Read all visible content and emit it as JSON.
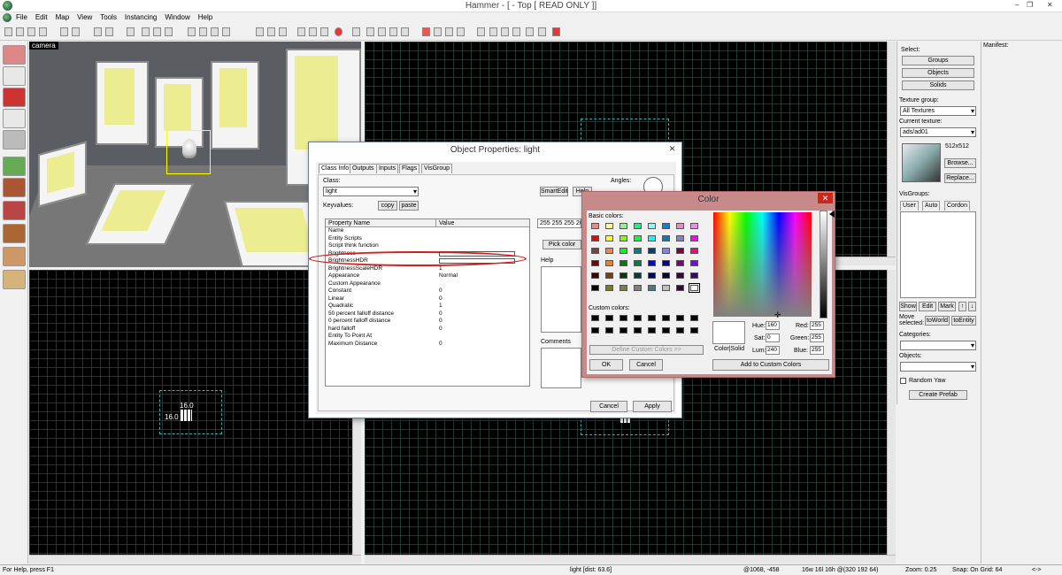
{
  "window": {
    "title": "Hammer - [ - Top [ READ ONLY ]]",
    "controls": [
      "–",
      "❐",
      "✕"
    ]
  },
  "menu": [
    "File",
    "Edit",
    "Map",
    "View",
    "Tools",
    "Instancing",
    "Window",
    "Help"
  ],
  "viewport3d": {
    "label": "camera"
  },
  "viewports": {
    "side_labels": [
      "16.0",
      "16.0"
    ],
    "size_w": "16.0",
    "size_h": "16.0"
  },
  "select_panel": {
    "select_label": "Select:",
    "groups": "Groups",
    "objects": "Objects",
    "solids": "Solids",
    "texture_group_label": "Texture group:",
    "texture_group": "All Textures",
    "current_texture_label": "Current texture:",
    "current_texture": "ads/ad01",
    "texture_size": "512x512",
    "browse": "Browse...",
    "replace": "Replace...",
    "visgroups_label": "VisGroups:",
    "vis_tabs": [
      "User",
      "Auto",
      "Cordon"
    ],
    "show": "Show",
    "edit": "Edit",
    "mark": "Mark",
    "up": "↑",
    "down": "↓",
    "move_selected": "Move selected:",
    "to_world": "toWorld",
    "to_entity": "toEntity",
    "categories_label": "Categories:",
    "objects_label": "Objects:",
    "random_yaw": "Random Yaw",
    "create_prefab": "Create Prefab"
  },
  "manifest": {
    "label": "Manifest:"
  },
  "object_properties": {
    "title": "Object Properties: light",
    "tabs": [
      "Class Info",
      "Outputs",
      "Inputs",
      "Flags",
      "VisGroup"
    ],
    "class_label": "Class:",
    "class_value": "light",
    "keyvalues_label": "Keyvalues:",
    "copy": "copy",
    "paste": "paste",
    "smartedit": "SmartEdit",
    "help_btn": "Help",
    "angles_label": "Angles:",
    "col_property": "Property Name",
    "col_value": "Value",
    "rows": [
      {
        "name": "Name",
        "value": ""
      },
      {
        "name": "Entity Scripts",
        "value": ""
      },
      {
        "name": "Script think function",
        "value": ""
      },
      {
        "name": "Brightness",
        "value": ""
      },
      {
        "name": "BrightnessHDR",
        "value": ""
      },
      {
        "name": "BrightnessScaleHDR",
        "value": "1"
      },
      {
        "name": "Appearance",
        "value": "Normal"
      },
      {
        "name": "Custom Appearance",
        "value": ""
      },
      {
        "name": "Constant",
        "value": "0"
      },
      {
        "name": "Linear",
        "value": "0"
      },
      {
        "name": "Quadratic",
        "value": "1"
      },
      {
        "name": "50 percent falloff distance",
        "value": "0"
      },
      {
        "name": "0 percent falloff distance",
        "value": "0"
      },
      {
        "name": "hard falloff",
        "value": "0"
      },
      {
        "name": "Entity To Point At",
        "value": ""
      },
      {
        "name": "Maximum Distance",
        "value": "0"
      }
    ],
    "value_field": "255 255 255 20",
    "pick_color": "Pick color",
    "help_label": "Help",
    "comments_label": "Comments",
    "cancel": "Cancel",
    "apply": "Apply"
  },
  "color_dialog": {
    "title": "Color",
    "basic_colors_label": "Basic colors:",
    "basic_colors": [
      "#ff8080",
      "#ffff80",
      "#80ff80",
      "#00ff80",
      "#80ffff",
      "#0080ff",
      "#ff80c0",
      "#ff80ff",
      "#ff0000",
      "#ffff00",
      "#80ff00",
      "#00ff40",
      "#00ffff",
      "#0080c0",
      "#8080c0",
      "#ff00ff",
      "#804040",
      "#ff8040",
      "#00ff00",
      "#008080",
      "#004080",
      "#8080ff",
      "#800040",
      "#ff0080",
      "#800000",
      "#ff8000",
      "#008000",
      "#008040",
      "#0000ff",
      "#0000a0",
      "#800080",
      "#8000ff",
      "#400000",
      "#804000",
      "#004000",
      "#004040",
      "#000080",
      "#000040",
      "#400040",
      "#400080",
      "#000000",
      "#808000",
      "#808040",
      "#808080",
      "#408080",
      "#c0c0c0",
      "#400040",
      "#ffffff"
    ],
    "custom_colors_label": "Custom colors:",
    "define_custom": "Define Custom Colors >>",
    "ok": "OK",
    "cancel": "Cancel",
    "color_solid": "Color|Solid",
    "hue_label": "Hue:",
    "hue": "160",
    "sat_label": "Sat:",
    "sat": "0",
    "lum_label": "Lum:",
    "lum": "240",
    "red_label": "Red:",
    "red": "255",
    "green_label": "Green:",
    "green": "255",
    "blue_label": "Blue:",
    "blue": "255",
    "add_custom": "Add to Custom Colors"
  },
  "status": {
    "help": "For Help, press F1",
    "object": "light  [dist: 63.6]",
    "coords": "@1068, -458",
    "size": "16w 16l 16h @(320 192 64)",
    "zoom": "Zoom: 0.25",
    "snap": "Snap: On Grid: 64",
    "nav": "<->"
  },
  "colors": {
    "accent": "#d02020",
    "highlight": "#c8898b"
  }
}
